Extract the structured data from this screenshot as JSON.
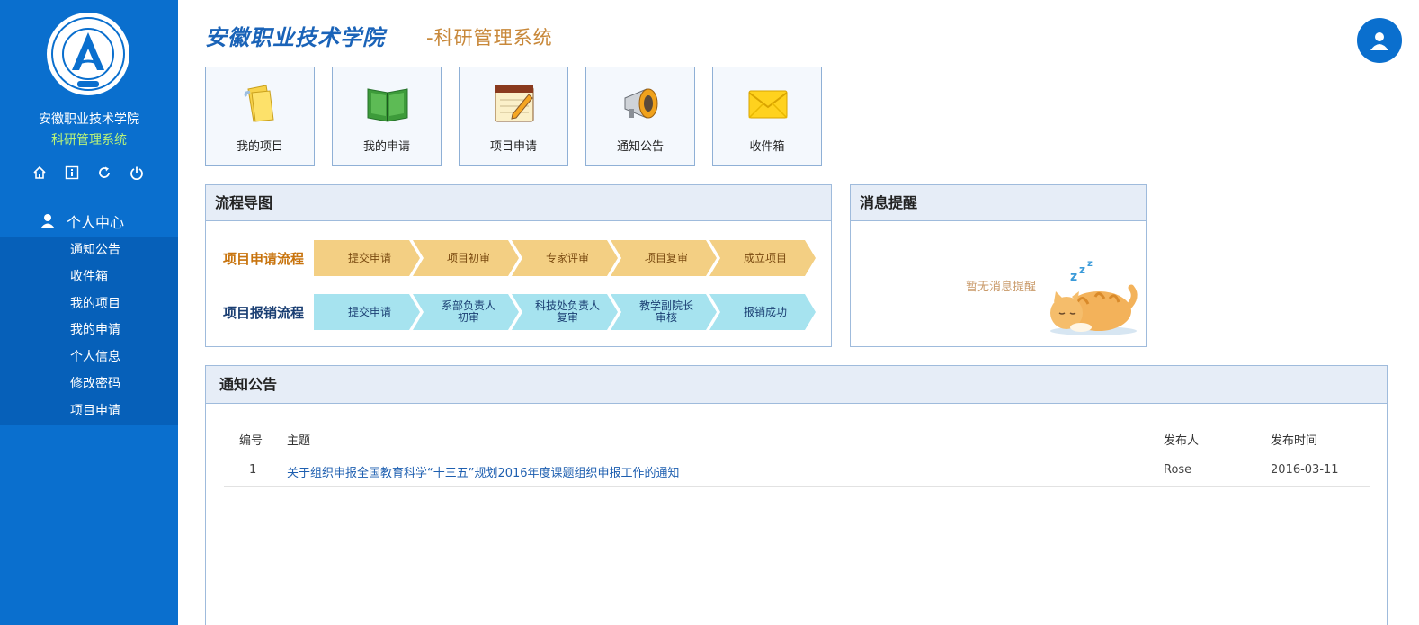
{
  "sidebar": {
    "school_name": "安徽职业技术学院",
    "system_name": "科研管理系统",
    "tools": [
      "home-icon",
      "info-icon",
      "refresh-icon",
      "power-icon"
    ],
    "section_label": "个人中心",
    "items": [
      {
        "label": "通知公告"
      },
      {
        "label": "收件箱"
      },
      {
        "label": "我的项目"
      },
      {
        "label": "我的申请"
      },
      {
        "label": "个人信息"
      },
      {
        "label": "修改密码"
      },
      {
        "label": "项目申请"
      }
    ]
  },
  "header": {
    "title": "安徽职业技术学院",
    "subtitle": "-科研管理系统"
  },
  "shortcuts": [
    {
      "label": "我的项目",
      "icon": "folder-icon"
    },
    {
      "label": "我的申请",
      "icon": "book-icon"
    },
    {
      "label": "项目申请",
      "icon": "notepad-icon"
    },
    {
      "label": "通知公告",
      "icon": "megaphone-icon"
    },
    {
      "label": "收件箱",
      "icon": "envelope-icon"
    }
  ],
  "flow_panel": {
    "title": "流程导图",
    "apply_flow": {
      "name": "项目申请流程",
      "color": "#c8740e",
      "step_color": "#f3cf83",
      "steps": [
        "提交申请",
        "项目初审",
        "专家评审",
        "项目复审",
        "成立项目"
      ]
    },
    "reimburse_flow": {
      "name": "项目报销流程",
      "color": "#1b3f73",
      "step_color": "#a6e3ef",
      "steps": [
        "提交申请",
        "系部负责人\n初审",
        "科技处负责人\n复审",
        "教学副院长\n审核",
        "报销成功"
      ]
    }
  },
  "message_panel": {
    "title": "消息提醒",
    "empty_text": "暂无消息提醒"
  },
  "notice_panel": {
    "title": "通知公告",
    "columns": [
      "编号",
      "主题",
      "发布人",
      "发布时间"
    ],
    "rows": [
      {
        "id": "1",
        "subject": "关于组织申报全国教育科学“十三五”规划2016年度课题组织申报工作的通知",
        "publisher": "Rose",
        "date": "2016-03-11"
      }
    ]
  },
  "colors": {
    "sidebar_bg": "#0a6fce",
    "sidebar_active_bg": "#0660b9",
    "system_name": "#b8f27a",
    "title_blue": "#1a63b8",
    "subtitle_orange": "#c8883a",
    "link_blue": "#1e5fb0"
  }
}
